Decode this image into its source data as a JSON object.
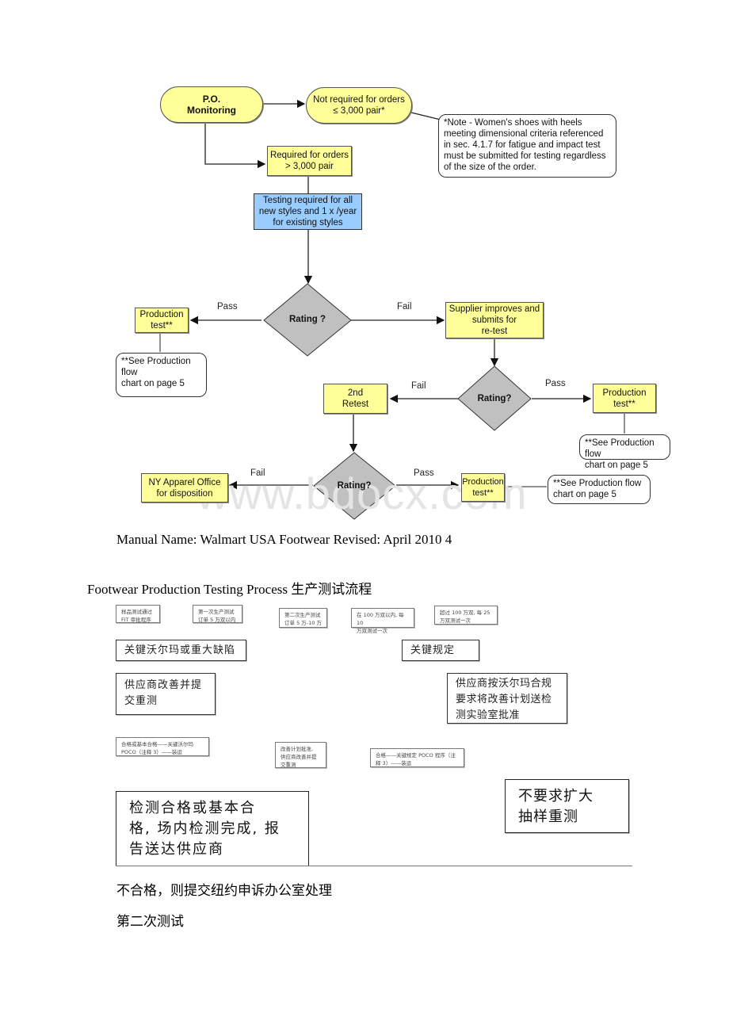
{
  "flowchart": {
    "po_monitoring": "P.O.\nMonitoring",
    "not_required": "Not required for orders\n≤ 3,000 pair*",
    "note_heels": "*Note - Women's shoes with heels meeting dimensional criteria referenced in sec. 4.1.7 for fatigue and impact test must be submitted for testing regardless of the size of the order.",
    "required": "Required for orders\n> 3,000 pair",
    "testing_required": "Testing required for all\nnew styles and 1 x /year\nfor existing styles",
    "rating_1": "Rating ?",
    "pass_1": "Pass",
    "fail_1": "Fail",
    "production_test_1": "Production\ntest**",
    "see_note_1": "**See Production\nflow\nchart on page 5",
    "supplier_improves": "Supplier improves and\nsubmits for\nre-test",
    "rating_2": "Rating?",
    "fail_2": "Fail",
    "pass_2": "Pass",
    "second_retest": "2nd\nRetest",
    "production_test_2": "Production\ntest**",
    "see_note_2": "**See Production flow\nchart on page 5",
    "rating_3": "Rating?",
    "fail_3": "Fail",
    "pass_3": "Pass",
    "ny_office": "NY Apparel Office\nfor disposition",
    "production_test_3": "Production\ntest**",
    "see_note_3": "**See Production flow\nchart on page 5"
  },
  "watermark": "www.bdocx.com",
  "footer_line": "Manual Name: Walmart USA Footwear Revised: April 2010 4",
  "section_title": "Footwear Production Testing Process 生产测试流程",
  "chinese_boxes": {
    "small_1": "样品测试通过\nFIT 审批程序",
    "small_2": "第一次生产测试\n订单 5 万双以内",
    "small_3": "第二次生产测试\n订单 5 万-10 万",
    "small_4": "在 100 万双以内, 每 10\n万双测试一次",
    "small_5": "超过 100 万双, 每 25\n万双测试一次",
    "key_defect": "关键沃尔玛或重大缺陷",
    "key_rule": "关键规定",
    "supplier_retest": "供应商改善并提\n交重测",
    "supplier_plan": "供应商按沃尔玛合规\n要求将改善计划送检\n测实验室批准",
    "small_6": "合格或基本合格——关键沃尔玛\nPOCO（注释 3）——装运",
    "small_7": "改善计划批准,\n供应商改善并提\n交重测",
    "small_8": "合格——关键规定 POCO 程序（注\n释 3）——装运",
    "big_1": "检测合格或基本合\n格, 场内检测完成, 报\n告送达供应商",
    "big_2": "不要求扩大\n抽样重测"
  },
  "para_1": "不合格，则提交纽约申诉办公室处理",
  "para_2": "第二次测试"
}
